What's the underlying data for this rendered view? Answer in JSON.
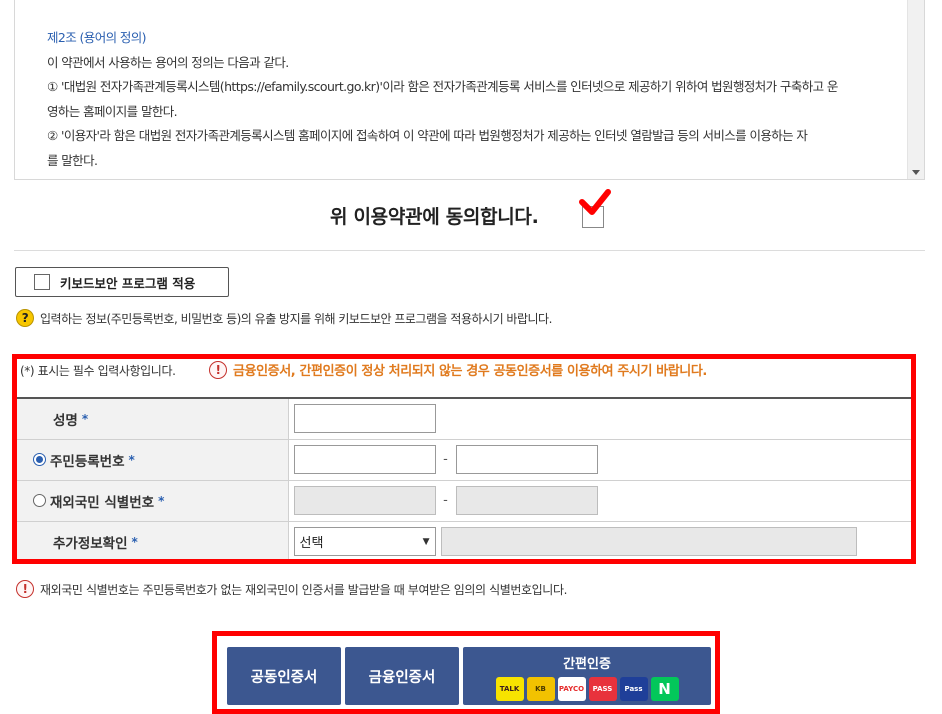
{
  "terms": {
    "heading": "제2조 (용어의 정의)",
    "lines": [
      "이 약관에서 사용하는 용어의 정의는 다음과 같다.",
      "① '대법원 전자가족관계등록시스템(https://efamily.scourt.go.kr)'이라 함은 전자가족관계등록 서비스를 인터넷으로 제공하기 위하여 법원행정처가 구축하고 운",
      "영하는 홈페이지를 말한다.",
      "② '이용자'라 함은 대법원 전자가족관계등록시스템 홈페이지에 접속하여 이 약관에 따라 법원행정처가 제공하는 인터넷 열람발급 등의 서비스를 이용하는 자",
      "를 말한다."
    ]
  },
  "agree": {
    "label": "위 이용약관에 동의합니다."
  },
  "keyboard": {
    "button_label": "키보드보안 프로그램 적용",
    "notice": "입력하는 정보(주민등록번호, 비밀번호 등)의 유출 방지를 위해 키보드보안 프로그램을 적용하시기 바랍니다."
  },
  "form": {
    "required_note": "(*) 표시는 필수 입력사항입니다.",
    "warning": "금융인증서, 간편인증이 정상 처리되지 않는 경우 공동인증서를 이용하여 주시기 바랍니다.",
    "rows": {
      "name": "성명",
      "rrn": "주민등록번호",
      "foreign": "재외국민 식별번호",
      "extra": "추가정보확인"
    },
    "star": "*",
    "dash": "-",
    "select_value": "선택"
  },
  "notice2": "재외국민 식별번호는 주민등록번호가 없는 재외국민이 인증서를 발급받을 때 부여받은 임의의 식별번호입니다.",
  "buttons": {
    "public_cert": "공동인증서",
    "financial_cert": "금융인증서",
    "easy_auth": "간편인증",
    "easy_icons": [
      "TALK",
      "KB",
      "PAYCO",
      "PASS",
      "Pass",
      "N"
    ]
  },
  "colors": {
    "accent": "#2a5fb0",
    "button": "#3c5790",
    "highlight": "#ff0000",
    "warning": "#e07a1e"
  }
}
